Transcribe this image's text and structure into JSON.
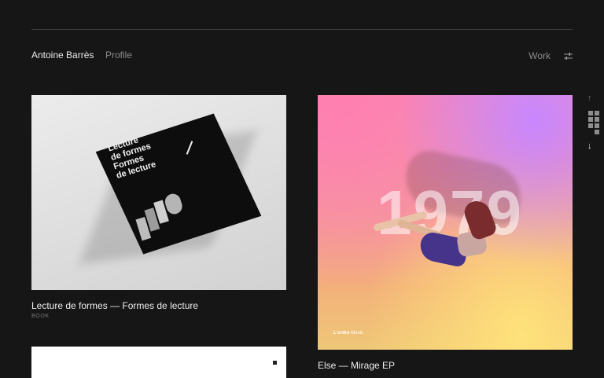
{
  "header": {
    "brand": "Antoine Barrès",
    "profile": "Profile",
    "work": "Work",
    "filter_icon": "sliders-icon"
  },
  "side_nav": {
    "up_icon": "arrow-up-icon",
    "grid_icon": "grid-view-icon",
    "down_icon": "arrow-down-icon"
  },
  "projects": [
    {
      "title": "Lecture de formes — Formes de lecture",
      "tag": "BOOK",
      "cover_lines": [
        "Lecture",
        "de formes",
        "Formes",
        "de lecture"
      ]
    },
    {
      "title": "Else — Mirage EP",
      "tag": "",
      "cover_year": "1979",
      "cover_label_bold": "L'ordre",
      "cover_label": "Music"
    },
    {
      "title": "",
      "tag": ""
    }
  ],
  "colors": {
    "background": "#161616",
    "text_primary": "#ededed",
    "text_muted": "#8a8a8a"
  }
}
